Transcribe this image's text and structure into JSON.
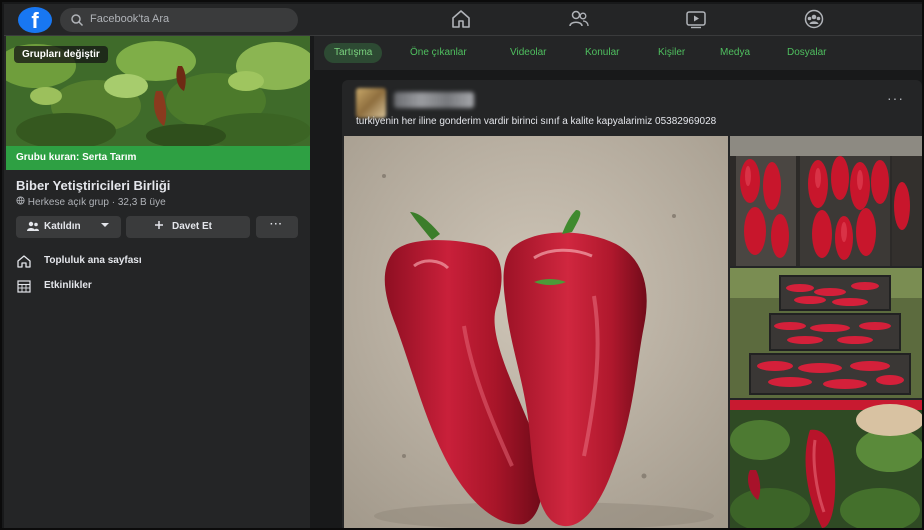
{
  "topbar": {
    "logo": "f",
    "search_placeholder": "Facebook'ta Ara",
    "icons": [
      "search-icon",
      "home-icon",
      "friends-icon",
      "watch-icon",
      "groups-icon"
    ]
  },
  "sidebar": {
    "switch_groups_label": "Grupları değiştir",
    "founder_label": "Grubu kuran: Serta Tarım",
    "group_name": "Biber Yetiştiricileri Birliği",
    "group_meta": "Herkese açık grup · 32,3 B üye",
    "joined_label": "Katıldın",
    "invite_label": "Davet Et",
    "more_label": "···",
    "links": [
      {
        "label": "Topluluk ana sayfası",
        "icon": "home-icon"
      },
      {
        "label": "Etkinlikler",
        "icon": "calendar-icon"
      }
    ]
  },
  "tabs": [
    {
      "label": "Tartışma",
      "active": true
    },
    {
      "label": "Öne çıkanlar",
      "active": false
    },
    {
      "label": "Videolar",
      "active": false
    },
    {
      "label": "Konular",
      "active": false
    },
    {
      "label": "Kişiler",
      "active": false
    },
    {
      "label": "Medya",
      "active": false
    },
    {
      "label": "Dosyalar",
      "active": false
    }
  ],
  "post": {
    "more_label": "···",
    "caption": "turkiyenin her iline gonderim vardir birinci sınıf a kalite kapyalarimiz 05382969028"
  },
  "colors": {
    "background": "#18191a",
    "panel": "#242526",
    "accent_green": "#2ea043",
    "tab_green": "#4fbf5f",
    "facebook_blue": "#1877f2"
  }
}
